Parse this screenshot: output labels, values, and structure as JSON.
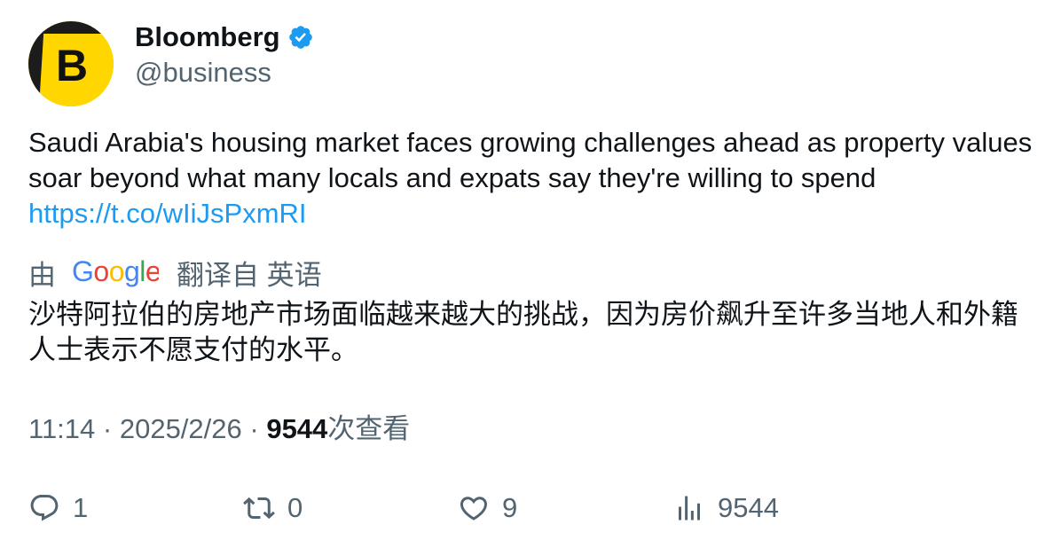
{
  "author": {
    "name": "Bloomberg",
    "handle": "@business",
    "avatar_letter": "B",
    "avatar_color": "#ffd600",
    "verified_color": "#1d9bf0",
    "verified_icon": "verified-badge-icon"
  },
  "tweet": {
    "text": "Saudi Arabia's housing market faces growing challenges ahead as property values soar beyond what many locals and expats say they're willing to spend",
    "link": "https://t.co/wIiJsPxmRI",
    "link_color": "#1d9bf0"
  },
  "translation": {
    "by_label": "由",
    "provider": "Google",
    "from_label": "翻译自 英语",
    "text": "沙特阿拉伯的房地产市场面临越来越大的挑战，因为房价飙升至许多当地人和外籍人士表示不愿支付的水平。"
  },
  "meta": {
    "time": "11:14",
    "separator": " · ",
    "date": "2025/2/26",
    "views_count": "9544",
    "views_label": "次查看"
  },
  "actions": {
    "reply": {
      "icon": "reply-icon",
      "count": "1"
    },
    "retweet": {
      "icon": "retweet-icon",
      "count": "0"
    },
    "like": {
      "icon": "heart-icon",
      "count": "9"
    },
    "views": {
      "icon": "views-bar-chart-icon",
      "count": "9544"
    }
  },
  "colors": {
    "text_primary": "#0f1419",
    "text_secondary": "#536471",
    "accent": "#1d9bf0"
  }
}
